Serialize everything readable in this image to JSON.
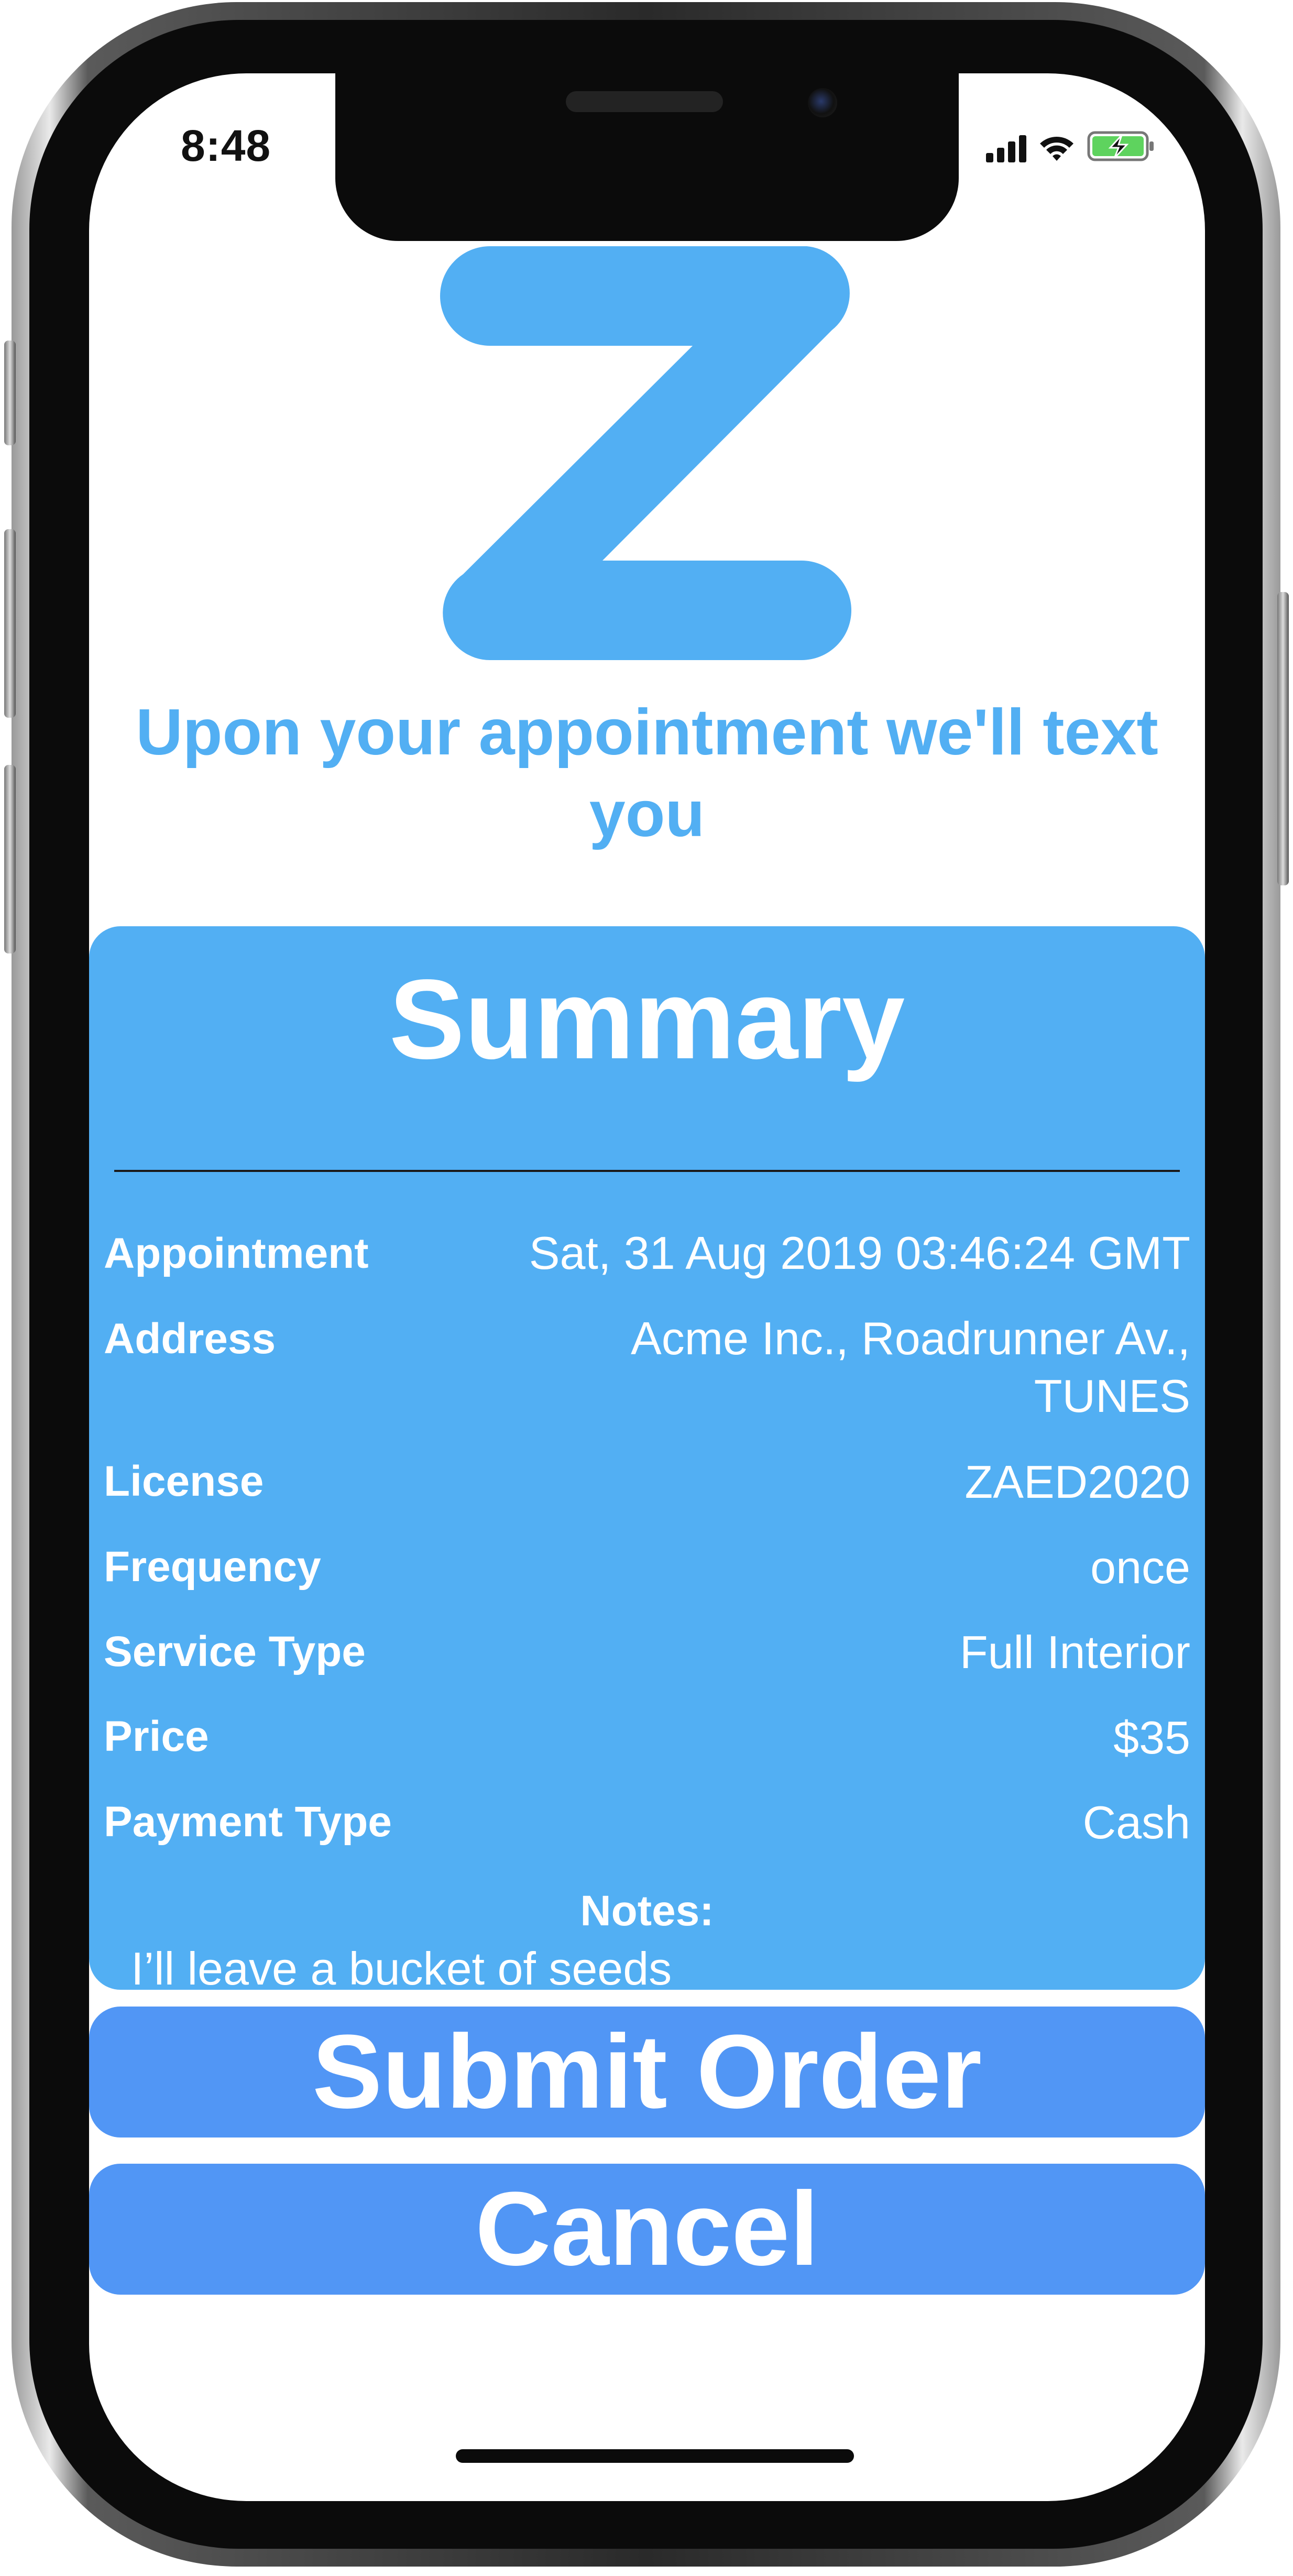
{
  "status_bar": {
    "time": "8:48"
  },
  "header": {
    "logo_icon": "z-logo",
    "tagline": "Upon your appointment we'll text you"
  },
  "summary": {
    "title": "Summary",
    "rows": [
      {
        "label": "Appointment",
        "value": "Sat, 31 Aug 2019 03:46:24 GMT"
      },
      {
        "label": "Address",
        "value_line1": "Acme Inc.,  Roadrunner Av.,",
        "value_line2": "TUNES"
      },
      {
        "label": "License",
        "value": "ZAED2020"
      },
      {
        "label": "Frequency",
        "value": "once"
      },
      {
        "label": "Service Type",
        "value": "Full Interior"
      },
      {
        "label": "Price",
        "value": "$35"
      },
      {
        "label": "Payment Type",
        "value": "Cash"
      }
    ],
    "notes_label": "Notes:",
    "notes_text": "I’ll leave a bucket of seeds"
  },
  "actions": {
    "submit_label": "Submit Order",
    "cancel_label": "Cancel"
  },
  "colors": {
    "brand_blue": "#52aff3",
    "button_blue": "#5196f5",
    "battery_green": "#5ed35e"
  }
}
